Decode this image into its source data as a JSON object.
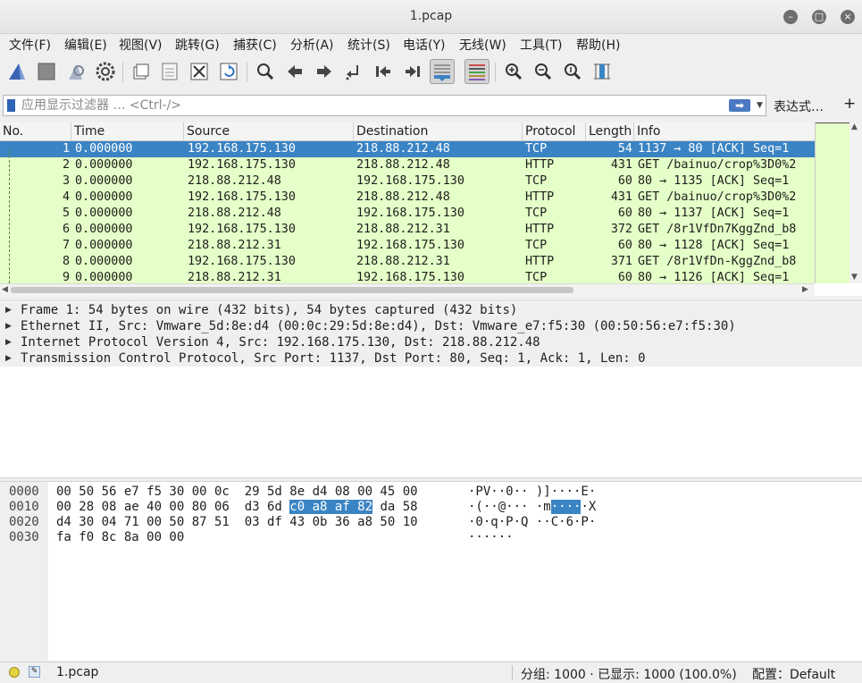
{
  "window": {
    "title": "1.pcap"
  },
  "menu": [
    "文件(F)",
    "编辑(E)",
    "视图(V)",
    "跳转(G)",
    "捕获(C)",
    "分析(A)",
    "统计(S)",
    "电话(Y)",
    "无线(W)",
    "工具(T)",
    "帮助(H)"
  ],
  "filter": {
    "placeholder": "应用显示过滤器 … <Ctrl-/>",
    "expression_label": "表达式…",
    "add_label": "+"
  },
  "columns": [
    "No.",
    "Time",
    "Source",
    "Destination",
    "Protocol",
    "Length",
    "Info"
  ],
  "packets": [
    {
      "no": "1",
      "time": "0.000000",
      "src": "192.168.175.130",
      "dst": "218.88.212.48",
      "proto": "TCP",
      "len": "54",
      "info": "1137 → 80 [ACK] Seq=1"
    },
    {
      "no": "2",
      "time": "0.000000",
      "src": "192.168.175.130",
      "dst": "218.88.212.48",
      "proto": "HTTP",
      "len": "431",
      "info": "GET /bainuo/crop%3D0%2"
    },
    {
      "no": "3",
      "time": "0.000000",
      "src": "218.88.212.48",
      "dst": "192.168.175.130",
      "proto": "TCP",
      "len": "60",
      "info": "80 → 1135 [ACK] Seq=1"
    },
    {
      "no": "4",
      "time": "0.000000",
      "src": "192.168.175.130",
      "dst": "218.88.212.48",
      "proto": "HTTP",
      "len": "431",
      "info": "GET /bainuo/crop%3D0%2"
    },
    {
      "no": "5",
      "time": "0.000000",
      "src": "218.88.212.48",
      "dst": "192.168.175.130",
      "proto": "TCP",
      "len": "60",
      "info": "80 → 1137 [ACK] Seq=1"
    },
    {
      "no": "6",
      "time": "0.000000",
      "src": "192.168.175.130",
      "dst": "218.88.212.31",
      "proto": "HTTP",
      "len": "372",
      "info": "GET /8r1VfDn7KggZnd_b8"
    },
    {
      "no": "7",
      "time": "0.000000",
      "src": "218.88.212.31",
      "dst": "192.168.175.130",
      "proto": "TCP",
      "len": "60",
      "info": "80 → 1128 [ACK] Seq=1"
    },
    {
      "no": "8",
      "time": "0.000000",
      "src": "192.168.175.130",
      "dst": "218.88.212.31",
      "proto": "HTTP",
      "len": "371",
      "info": "GET /8r1VfDn-KggZnd_b8"
    },
    {
      "no": "9",
      "time": "0.000000",
      "src": "218.88.212.31",
      "dst": "192.168.175.130",
      "proto": "TCP",
      "len": "60",
      "info": "80 → 1126 [ACK] Seq=1"
    }
  ],
  "details": [
    "Frame 1: 54 bytes on wire (432 bits), 54 bytes captured (432 bits)",
    "Ethernet II, Src: Vmware_5d:8e:d4 (00:0c:29:5d:8e:d4), Dst: Vmware_e7:f5:30 (00:50:56:e7:f5:30)",
    "Internet Protocol Version 4, Src: 192.168.175.130, Dst: 218.88.212.48",
    "Transmission Control Protocol, Src Port: 1137, Dst Port: 80, Seq: 1, Ack: 1, Len: 0"
  ],
  "bytes": [
    {
      "offset": "0000",
      "hex_a": "00 50 56 e7 f5 30 00 0c  29 5d 8e d4 08 00 45 00",
      "hex_hl": "",
      "hex_b": "",
      "ascii_a": "·PV··0·· )]····E·",
      "ascii_hl": "",
      "ascii_b": ""
    },
    {
      "offset": "0010",
      "hex_a": "00 28 08 ae 40 00 80 06  d3 6d ",
      "hex_hl": "c0 a8 af 82",
      "hex_b": " da 58",
      "ascii_a": "·(··@··· ·m",
      "ascii_hl": "····",
      "ascii_b": "·X"
    },
    {
      "offset": "0020",
      "hex_a": "d4 30 04 71 00 50 87 51  03 df 43 0b 36 a8 50 10",
      "hex_hl": "",
      "hex_b": "",
      "ascii_a": "·0·q·P·Q ··C·6·P·",
      "ascii_hl": "",
      "ascii_b": ""
    },
    {
      "offset": "0030",
      "hex_a": "fa f0 8c 8a 00 00",
      "hex_hl": "",
      "hex_b": "",
      "ascii_a": "······",
      "ascii_hl": "",
      "ascii_b": ""
    }
  ],
  "status": {
    "file": "1.pcap",
    "counts": "分组: 1000 · 已显示: 1000 (100.0%)",
    "profile": "配置：Default"
  },
  "colors": {
    "row_bg": "#e4ffc7",
    "selected": "#3b84c4"
  },
  "toolbar_icons": [
    "shark-fin-icon",
    "stop-icon",
    "restart-icon",
    "options-gear-icon",
    "open-file-icon",
    "save-icon",
    "close-file-icon",
    "reload-icon",
    "search-icon",
    "back-arrow-icon",
    "forward-arrow-icon",
    "go-to-packet-icon",
    "first-packet-icon",
    "last-packet-icon",
    "auto-scroll-icon",
    "colorize-icon",
    "zoom-in-icon",
    "zoom-out-icon",
    "normal-size-icon",
    "resize-columns-icon"
  ]
}
